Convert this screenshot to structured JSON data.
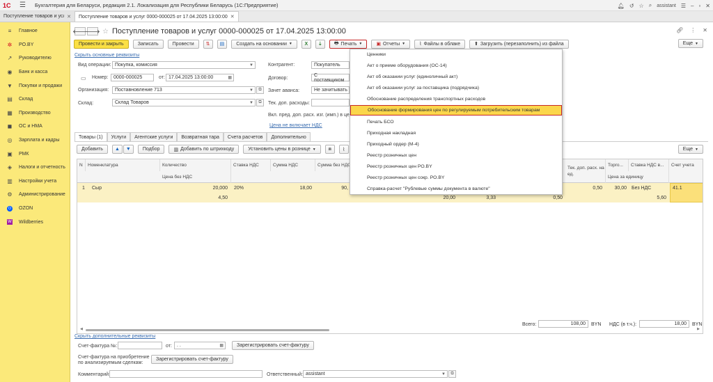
{
  "app": {
    "logo": "1С",
    "title": "Бухгалтерия для Беларуси, редакция 2.1. Локализация для Республики Беларусь   (1С:Предприятие)",
    "user": "assistant"
  },
  "tabs": [
    {
      "label": "Поступление товаров и услуг"
    },
    {
      "label": "Поступление товаров и услуг 0000-000025 от 17.04.2025 13:00:00"
    }
  ],
  "sidebar": {
    "items": [
      {
        "label": "Главное",
        "icon": "≡"
      },
      {
        "label": "PO.BY",
        "icon": "✲"
      },
      {
        "label": "Руководителю",
        "icon": "↗"
      },
      {
        "label": "Банк и касса",
        "icon": "◉"
      },
      {
        "label": "Покупки и продажи",
        "icon": "▼"
      },
      {
        "label": "Склад",
        "icon": "▤"
      },
      {
        "label": "Производство",
        "icon": "▦"
      },
      {
        "label": "ОС и НМА",
        "icon": "◼"
      },
      {
        "label": "Зарплата и кадры",
        "icon": "◎"
      },
      {
        "label": "РМК",
        "icon": "▣"
      },
      {
        "label": "Налоги и отчетность",
        "icon": "◈"
      },
      {
        "label": "Настройки учета",
        "icon": "▥"
      },
      {
        "label": "Администрирование",
        "icon": "⚙"
      },
      {
        "label": "OZON",
        "icon": "O"
      },
      {
        "label": "Wildberries",
        "icon": "W"
      }
    ]
  },
  "document": {
    "title": "Поступление товаров и услуг 0000-000025 от 17.04.2025 13:00:00"
  },
  "toolbar": {
    "post_close": "Провести и закрыть",
    "write": "Записать",
    "post": "Провести",
    "create_based": "Создать на основании",
    "print": "Печать",
    "reports": "Отчеты",
    "cloud_files": "Файлы в облаке",
    "upload": "Загрузить (перезаполнить) из файла",
    "more": "Еще"
  },
  "form": {
    "hide_link": "Скрыть основные реквизиты",
    "op_type_label": "Вид операции:",
    "op_type_value": "Покупка, комиссия",
    "number_label": "Номер:",
    "number_value": "0000-000025",
    "date_label": "от:",
    "date_value": "17.04.2025 13:00:00",
    "org_label": "Организация:",
    "org_value": "Поставновление 713",
    "warehouse_label": "Склад:",
    "warehouse_value": "Склад Товаров",
    "contractor_label": "Контрагент:",
    "contractor_value": "Покупатель",
    "contract_label": "Договор:",
    "contract_value": "С поставщиком",
    "advance_label": "Зачет аванса:",
    "advance_value": "Не зачитывать",
    "extra_exp_label": "Тек. доп. расходы:",
    "extra_exp_note": "Вкл. пред. доп. расх. изг. (имп.) в цен",
    "price_link": "Цена не включает НДС"
  },
  "subtabs": [
    "Товары (1)",
    "Услуги",
    "Агентские услуги",
    "Возвратная тара",
    "Счета расчетов",
    "Дополнительно"
  ],
  "table_toolbar": {
    "add": "Добавить",
    "pick": "Подбор",
    "barcode": "Добавить по штрихкоду",
    "set_prices": "Установить цены в рознице",
    "more": "Еще"
  },
  "grid": {
    "headers": {
      "n": "N",
      "item": "Номенклатура",
      "qty": "Количество",
      "price_no_vat": "Цена без НДС",
      "vat_rate": "Ставка НДС",
      "vat_sum": "Сумма НДС",
      "sum_no_vat": "Сумма без НДС",
      "extra": "Тек. доп. расх. на ед.",
      "trade": "Торго...",
      "trade_vat": "Ставка НДС в...",
      "price_sub": "Цена за единицу",
      "account": "Счет учета"
    },
    "row": {
      "n": "1",
      "item": "Сыр",
      "qty": "20,000",
      "price": "4,50",
      "vat_rate": "20%",
      "vat_sum": "18,00",
      "sum_no_vat": "90,",
      "v1": "20,00",
      "v2": "3,33",
      "v3": "0,50",
      "extra": "0,50",
      "trade": "30,00",
      "trade_vat": "Без НДС",
      "trade_vat2": "5,60",
      "account": "41.1"
    }
  },
  "totals": {
    "total_label": "Всего:",
    "total_value": "108,00",
    "currency": "BYN",
    "vat_label": "НДС (в т.ч.):",
    "vat_value": "18,00",
    "vat_currency": "BYN"
  },
  "footer": {
    "hide_extra_link": "Скрыть дополнительные реквизиты",
    "invoice_label": "Счет-фактура №:",
    "invoice_date_label": "от:",
    "invoice_date_value": " .  .",
    "register_btn": "Зарегистрировать счет-фактуру",
    "invoice_purchase_label1": "Счет-фактура на приобретение",
    "invoice_purchase_label2": "по анализируемым сделкам:",
    "register_btn2": "Зарегистрировать счет-фактуру",
    "comment_label": "Комментарий:",
    "responsible_label": "Ответственный:",
    "responsible_value": "assistant"
  },
  "print_menu": {
    "items": [
      "Ценники",
      "Акт о приеме оборудования (ОС-14)",
      "Акт об оказании услуг (единоличный акт)",
      "Акт об оказании услуг за поставщика (подрядчика)",
      "Обоснование распределения транспортных расходов",
      "Обоснование формирования цен по регулируемым потребительским товарам",
      "Печать БСО",
      "Приходная накладная",
      "Приходный ордер (М-4)",
      "Реестр розничных цен",
      "Реестр розничных цен PO.BY",
      "Реестр розничных цен сокр. PO.BY",
      "Справка-расчет \"Рублевые суммы документа в валюте\""
    ],
    "highlighted_index": 5
  }
}
